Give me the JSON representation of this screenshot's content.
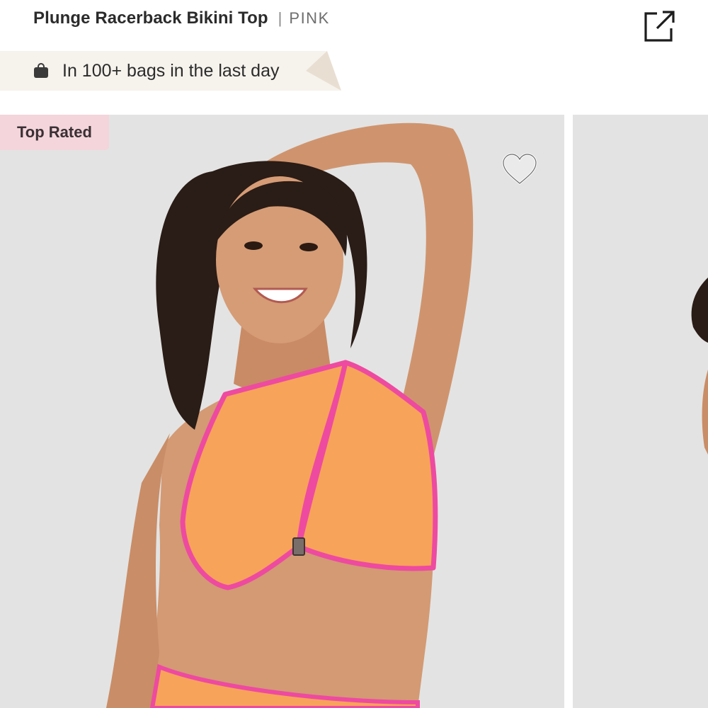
{
  "header": {
    "product_name": "Plunge Racerback Bikini Top",
    "separator": "|",
    "brand": "PINK",
    "share_icon": "share-external-icon"
  },
  "banner": {
    "icon": "shopping-bag-icon",
    "text": "In 100+ bags in the last day"
  },
  "gallery": {
    "badge": "Top Rated",
    "favorite_icon": "heart-outline-icon"
  },
  "colors": {
    "banner_bg": "#f6f2ec",
    "banner_tail": "#e8dfd2",
    "badge_bg": "#f3d5db",
    "slide_bg": "#e3e3e3",
    "bikini_orange": "#f7a35a",
    "bikini_trim_pink": "#ee4aa0",
    "skin": "#d29873",
    "hair": "#2a1c16"
  }
}
